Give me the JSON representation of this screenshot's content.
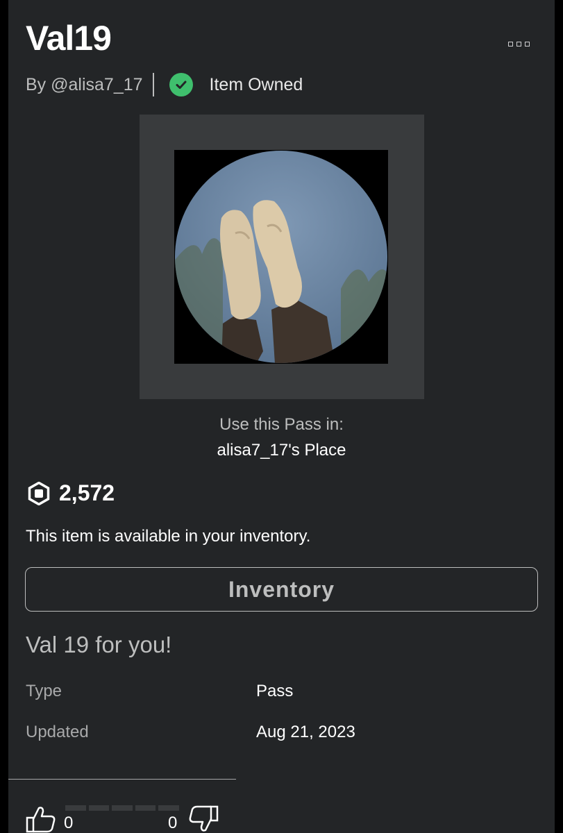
{
  "item": {
    "title": "Val19",
    "creator": "By @alisa7_17",
    "owned_status": "Item Owned"
  },
  "thumbnail": {
    "alt": "Val19"
  },
  "use_in": {
    "label": "Use this Pass in:",
    "place": "alisa7_17's Place"
  },
  "price": {
    "currency_icon": "robux-icon",
    "amount": "2,572"
  },
  "availability": "This item is available in your inventory.",
  "inventory_button": "Inventory",
  "description": "Val 19 for you!",
  "details": {
    "type_label": "Type",
    "type_value": "Pass",
    "updated_label": "Updated",
    "updated_value": "Aug 21, 2023"
  },
  "votes": {
    "up_count": "0",
    "down_count": "0",
    "up_icon": "thumbs-up-icon",
    "down_icon": "thumbs-down-icon"
  },
  "colors": {
    "background": "#232527",
    "panel": "#393b3d",
    "text_primary": "#ffffff",
    "text_secondary": "#bdbebe",
    "owned_green": "#3fbf6d"
  }
}
